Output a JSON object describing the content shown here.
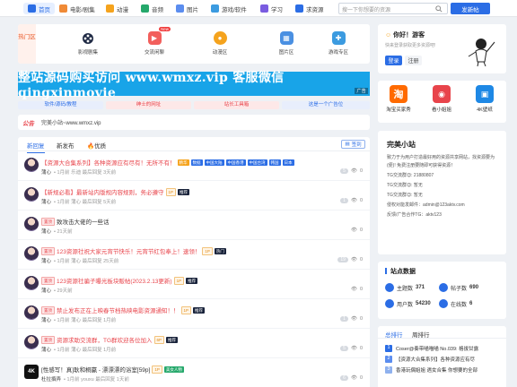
{
  "nav": {
    "items": [
      {
        "label": "首页",
        "icon": "home-icon",
        "color": "#2b6de5"
      },
      {
        "label": "电影/剧集",
        "icon": "movie-icon",
        "color": "#f08a36"
      },
      {
        "label": "动漫",
        "icon": "anime-icon",
        "color": "#f5a31d"
      },
      {
        "label": "音频",
        "icon": "audio-icon",
        "color": "#25a86b"
      },
      {
        "label": "图片",
        "icon": "image-icon",
        "color": "#5b8def"
      },
      {
        "label": "游戏/软件",
        "icon": "game-icon",
        "color": "#3c9be0"
      },
      {
        "label": "学习",
        "icon": "study-icon",
        "color": "#7a5ce0"
      },
      {
        "label": "求资源",
        "icon": "request-icon",
        "color": "#2b6de5"
      }
    ],
    "search_placeholder": "搜一下你想要的资源",
    "post_label": "发新帖"
  },
  "quick": {
    "hot_label": "热门区",
    "items": [
      {
        "label": "影视剧集",
        "icon": "film-reel-icon",
        "color": "#ffffff"
      },
      {
        "label": "交流闲聊",
        "icon": "chat-icon",
        "color": "#f25f5c"
      },
      {
        "label": "动漫区",
        "icon": "bear-icon",
        "color": "#f5a31d"
      },
      {
        "label": "图片区",
        "icon": "picture-icon",
        "color": "#4a90e2"
      },
      {
        "label": "游戏专区",
        "icon": "gamepad-icon",
        "color": "#3c9be0"
      }
    ],
    "new_tag": "New"
  },
  "banner": {
    "text": "整站源码购买访问 www.wmxz.vip 客服微信 qingxinmovie",
    "ad_label": "广告"
  },
  "tag_links": [
    {
      "label": "软件/源码/教程",
      "color": "#e8eefc",
      "text_color": "#2b6de5"
    },
    {
      "label": "绅士的网址",
      "color": "#fde8e8",
      "text_color": "#e8444b"
    },
    {
      "label": "站长工具箱",
      "color": "#fde8e8",
      "text_color": "#e8444b"
    },
    {
      "label": "这是一个广告位",
      "color": "#e8eefc",
      "text_color": "#2b6de5"
    }
  ],
  "notice": {
    "label": "公告",
    "text": "完美小站~www.wmxz.vip"
  },
  "tabs": [
    {
      "label": "新回复"
    },
    {
      "label": "新发布"
    },
    {
      "label": "优质"
    }
  ],
  "signin_label": "签到",
  "threads": [
    {
      "title": "【资源大合集系列】各种资源应有尽有！无所不有！",
      "title_color": "red",
      "pre_badges": [],
      "post_badges": [
        {
          "text": "精华",
          "style": "b-ess"
        },
        {
          "text": "数据",
          "style": "b-blue"
        },
        {
          "text": "中国大陆",
          "style": "b-blue"
        },
        {
          "text": "中国香港",
          "style": "b-blue"
        },
        {
          "text": "中国台湾",
          "style": "b-blue"
        },
        {
          "text": "韩国",
          "style": "b-blue"
        },
        {
          "text": "日本",
          "style": "b-blue"
        }
      ],
      "author": "蒲心",
      "date": "1月前",
      "last_user": "乐迪",
      "last_time": "最后回复 3天前",
      "replies": "5",
      "views": "0",
      "avatar": "anime"
    },
    {
      "title": "【新规必看】最新站内版规内容规则，务必遵守",
      "title_color": "red",
      "pre_badges": [],
      "post_badges": [
        {
          "text": "1P",
          "style": "b-gold"
        },
        {
          "text": "推荐",
          "style": "b-rec"
        }
      ],
      "author": "蒲心",
      "date": "1月前",
      "last_user": "蒲心",
      "last_time": "最后回复 5天前",
      "replies": "1",
      "views": "0",
      "avatar": "anime"
    },
    {
      "title": "致攻击大佬的一些话",
      "title_color": "plain",
      "pre_badges": [
        {
          "text": "置顶",
          "style": "b-top"
        }
      ],
      "post_badges": [],
      "author": "蒲心",
      "date": "21天前",
      "last_user": "",
      "last_time": "",
      "replies": "",
      "views": "0",
      "avatar": "anime"
    },
    {
      "title": "123资源社祝大家元宵节快乐！元宵节红包奉上！速领！",
      "title_color": "red",
      "pre_badges": [
        {
          "text": "置顶",
          "style": "b-top"
        }
      ],
      "post_badges": [
        {
          "text": "1P",
          "style": "b-gold"
        },
        {
          "text": "热门",
          "style": "b-hot"
        }
      ],
      "author": "蒲心",
      "date": "1月前",
      "last_user": "蒲心",
      "last_time": "最后回复 25天前",
      "replies": "19",
      "views": "0",
      "avatar": "anime"
    },
    {
      "title": "123资源社骗子曝光板块贩帖(2023.2.13更新)",
      "title_color": "red",
      "pre_badges": [
        {
          "text": "置顶",
          "style": "b-top"
        }
      ],
      "post_badges": [
        {
          "text": "1P",
          "style": "b-gold"
        },
        {
          "text": "推荐",
          "style": "b-rec"
        }
      ],
      "author": "蒲心",
      "date": "29天前",
      "last_user": "",
      "last_time": "",
      "replies": "",
      "views": "0",
      "avatar": "anime"
    },
    {
      "title": "禁止发布正在上映春节档热映电影资源通知！！",
      "title_color": "red",
      "pre_badges": [
        {
          "text": "置顶",
          "style": "b-top"
        }
      ],
      "post_badges": [
        {
          "text": "1P",
          "style": "b-gold"
        },
        {
          "text": "推荐",
          "style": "b-rec"
        }
      ],
      "author": "蒲心",
      "date": "1月前",
      "last_user": "蒲心",
      "last_time": "最后回复 1月前",
      "replies": "1",
      "views": "0",
      "avatar": "anime"
    },
    {
      "title": "资源求助交流群，TG群欢迎各位加入",
      "title_color": "red",
      "pre_badges": [
        {
          "text": "置顶",
          "style": "b-top"
        }
      ],
      "post_badges": [
        {
          "text": "6P",
          "style": "b-gold"
        },
        {
          "text": "推荐",
          "style": "b-rec"
        }
      ],
      "author": "蒲心",
      "date": "1月前",
      "last_user": "蒲心",
      "last_time": "最后回复 1月前",
      "replies": "5",
      "views": "0",
      "avatar": "anime"
    },
    {
      "title": "[性感写！真]耿和桐赢 - 漂漂漂的浴室[59p]",
      "title_color": "plain",
      "pre_badges": [],
      "post_badges": [
        {
          "text": "1P",
          "style": "b-gold"
        },
        {
          "text": "美女人物",
          "style": "b-green"
        }
      ],
      "author": "杜拉撰弄",
      "date": "1月前",
      "last_user": "youxu",
      "last_time": "最后回复 1天前",
      "replies": "6",
      "views": "0",
      "avatar": "k4"
    }
  ],
  "user_card": {
    "greeting": "你好！游客",
    "sub": "快来登录获取更多资源吧!",
    "login": "登录",
    "register": "注册"
  },
  "side_ads": [
    {
      "label": "淘宝买家秀",
      "icon": "taobao-icon",
      "color": "#ff6a00",
      "glyph": "淘"
    },
    {
      "label": "看小姐姐",
      "icon": "girl-icon",
      "color": "#e8444b",
      "glyph": "◉"
    },
    {
      "label": "4K壁纸",
      "icon": "wallpaper-icon",
      "color": "#1e88e5",
      "glyph": "▣"
    }
  ],
  "about": {
    "title": "完美小站",
    "lines": [
      "致力于为用户打造最好用的资源共享网站，找资源要为(便)! 免费注册要随即可获得资源！",
      "TG交流群😊: 21880807",
      "TG交流群😊: 暂无",
      "TG交流群😊: 暂无",
      "侵权对能发邮件：admin@123aktv.com",
      "反馈/广告合作TG：aktv123"
    ]
  },
  "stats": {
    "title": "站点数据",
    "topics_label": "主题数",
    "topics": "371",
    "posts_label": "帖子数",
    "posts": "690",
    "users_label": "用户数",
    "users": "54230",
    "online_label": "在线数",
    "online": "6"
  },
  "rank": {
    "tabs": [
      "总排行",
      "周排行"
    ],
    "items": [
      {
        "n": "1",
        "title": "Coser@奏带喵喵喵 No.039: 格拔甘露"
      },
      {
        "n": "2",
        "title": "【资源大合集系列】各种资源应有尽"
      },
      {
        "n": "3",
        "title": "香港玩偶姐姐 遇女合集 你想要的全部"
      }
    ]
  }
}
